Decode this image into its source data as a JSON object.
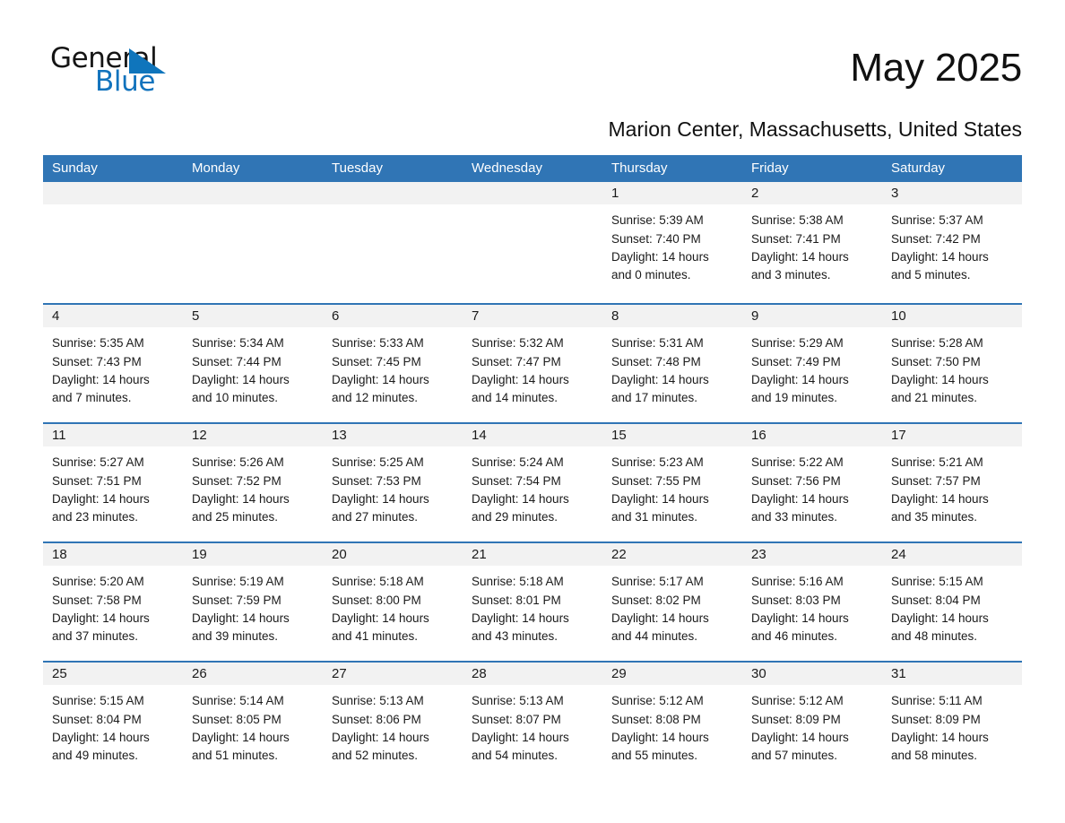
{
  "logo": {
    "word_one": "General",
    "word_two": "Blue",
    "triangle_color": "#0f75bc",
    "blue_text_color": "#1273bd"
  },
  "header": {
    "month_year": "May 2025",
    "location": "Marion Center, Massachusetts, United States",
    "header_bg_color": "#3075b5",
    "day_band_color": "#f2f2f2"
  },
  "weekdays": [
    "Sunday",
    "Monday",
    "Tuesday",
    "Wednesday",
    "Thursday",
    "Friday",
    "Saturday"
  ],
  "weeks": [
    [
      {
        "empty": true,
        "day": ""
      },
      {
        "empty": true,
        "day": ""
      },
      {
        "empty": true,
        "day": ""
      },
      {
        "empty": true,
        "day": ""
      },
      {
        "day": "1",
        "sunrise": "Sunrise: 5:39 AM",
        "sunset": "Sunset: 7:40 PM",
        "daylight_line1": "Daylight: 14 hours",
        "daylight_line2": "and 0 minutes."
      },
      {
        "day": "2",
        "sunrise": "Sunrise: 5:38 AM",
        "sunset": "Sunset: 7:41 PM",
        "daylight_line1": "Daylight: 14 hours",
        "daylight_line2": "and 3 minutes."
      },
      {
        "day": "3",
        "sunrise": "Sunrise: 5:37 AM",
        "sunset": "Sunset: 7:42 PM",
        "daylight_line1": "Daylight: 14 hours",
        "daylight_line2": "and 5 minutes."
      }
    ],
    [
      {
        "day": "4",
        "sunrise": "Sunrise: 5:35 AM",
        "sunset": "Sunset: 7:43 PM",
        "daylight_line1": "Daylight: 14 hours",
        "daylight_line2": "and 7 minutes."
      },
      {
        "day": "5",
        "sunrise": "Sunrise: 5:34 AM",
        "sunset": "Sunset: 7:44 PM",
        "daylight_line1": "Daylight: 14 hours",
        "daylight_line2": "and 10 minutes."
      },
      {
        "day": "6",
        "sunrise": "Sunrise: 5:33 AM",
        "sunset": "Sunset: 7:45 PM",
        "daylight_line1": "Daylight: 14 hours",
        "daylight_line2": "and 12 minutes."
      },
      {
        "day": "7",
        "sunrise": "Sunrise: 5:32 AM",
        "sunset": "Sunset: 7:47 PM",
        "daylight_line1": "Daylight: 14 hours",
        "daylight_line2": "and 14 minutes."
      },
      {
        "day": "8",
        "sunrise": "Sunrise: 5:31 AM",
        "sunset": "Sunset: 7:48 PM",
        "daylight_line1": "Daylight: 14 hours",
        "daylight_line2": "and 17 minutes."
      },
      {
        "day": "9",
        "sunrise": "Sunrise: 5:29 AM",
        "sunset": "Sunset: 7:49 PM",
        "daylight_line1": "Daylight: 14 hours",
        "daylight_line2": "and 19 minutes."
      },
      {
        "day": "10",
        "sunrise": "Sunrise: 5:28 AM",
        "sunset": "Sunset: 7:50 PM",
        "daylight_line1": "Daylight: 14 hours",
        "daylight_line2": "and 21 minutes."
      }
    ],
    [
      {
        "day": "11",
        "sunrise": "Sunrise: 5:27 AM",
        "sunset": "Sunset: 7:51 PM",
        "daylight_line1": "Daylight: 14 hours",
        "daylight_line2": "and 23 minutes."
      },
      {
        "day": "12",
        "sunrise": "Sunrise: 5:26 AM",
        "sunset": "Sunset: 7:52 PM",
        "daylight_line1": "Daylight: 14 hours",
        "daylight_line2": "and 25 minutes."
      },
      {
        "day": "13",
        "sunrise": "Sunrise: 5:25 AM",
        "sunset": "Sunset: 7:53 PM",
        "daylight_line1": "Daylight: 14 hours",
        "daylight_line2": "and 27 minutes."
      },
      {
        "day": "14",
        "sunrise": "Sunrise: 5:24 AM",
        "sunset": "Sunset: 7:54 PM",
        "daylight_line1": "Daylight: 14 hours",
        "daylight_line2": "and 29 minutes."
      },
      {
        "day": "15",
        "sunrise": "Sunrise: 5:23 AM",
        "sunset": "Sunset: 7:55 PM",
        "daylight_line1": "Daylight: 14 hours",
        "daylight_line2": "and 31 minutes."
      },
      {
        "day": "16",
        "sunrise": "Sunrise: 5:22 AM",
        "sunset": "Sunset: 7:56 PM",
        "daylight_line1": "Daylight: 14 hours",
        "daylight_line2": "and 33 minutes."
      },
      {
        "day": "17",
        "sunrise": "Sunrise: 5:21 AM",
        "sunset": "Sunset: 7:57 PM",
        "daylight_line1": "Daylight: 14 hours",
        "daylight_line2": "and 35 minutes."
      }
    ],
    [
      {
        "day": "18",
        "sunrise": "Sunrise: 5:20 AM",
        "sunset": "Sunset: 7:58 PM",
        "daylight_line1": "Daylight: 14 hours",
        "daylight_line2": "and 37 minutes."
      },
      {
        "day": "19",
        "sunrise": "Sunrise: 5:19 AM",
        "sunset": "Sunset: 7:59 PM",
        "daylight_line1": "Daylight: 14 hours",
        "daylight_line2": "and 39 minutes."
      },
      {
        "day": "20",
        "sunrise": "Sunrise: 5:18 AM",
        "sunset": "Sunset: 8:00 PM",
        "daylight_line1": "Daylight: 14 hours",
        "daylight_line2": "and 41 minutes."
      },
      {
        "day": "21",
        "sunrise": "Sunrise: 5:18 AM",
        "sunset": "Sunset: 8:01 PM",
        "daylight_line1": "Daylight: 14 hours",
        "daylight_line2": "and 43 minutes."
      },
      {
        "day": "22",
        "sunrise": "Sunrise: 5:17 AM",
        "sunset": "Sunset: 8:02 PM",
        "daylight_line1": "Daylight: 14 hours",
        "daylight_line2": "and 44 minutes."
      },
      {
        "day": "23",
        "sunrise": "Sunrise: 5:16 AM",
        "sunset": "Sunset: 8:03 PM",
        "daylight_line1": "Daylight: 14 hours",
        "daylight_line2": "and 46 minutes."
      },
      {
        "day": "24",
        "sunrise": "Sunrise: 5:15 AM",
        "sunset": "Sunset: 8:04 PM",
        "daylight_line1": "Daylight: 14 hours",
        "daylight_line2": "and 48 minutes."
      }
    ],
    [
      {
        "day": "25",
        "sunrise": "Sunrise: 5:15 AM",
        "sunset": "Sunset: 8:04 PM",
        "daylight_line1": "Daylight: 14 hours",
        "daylight_line2": "and 49 minutes."
      },
      {
        "day": "26",
        "sunrise": "Sunrise: 5:14 AM",
        "sunset": "Sunset: 8:05 PM",
        "daylight_line1": "Daylight: 14 hours",
        "daylight_line2": "and 51 minutes."
      },
      {
        "day": "27",
        "sunrise": "Sunrise: 5:13 AM",
        "sunset": "Sunset: 8:06 PM",
        "daylight_line1": "Daylight: 14 hours",
        "daylight_line2": "and 52 minutes."
      },
      {
        "day": "28",
        "sunrise": "Sunrise: 5:13 AM",
        "sunset": "Sunset: 8:07 PM",
        "daylight_line1": "Daylight: 14 hours",
        "daylight_line2": "and 54 minutes."
      },
      {
        "day": "29",
        "sunrise": "Sunrise: 5:12 AM",
        "sunset": "Sunset: 8:08 PM",
        "daylight_line1": "Daylight: 14 hours",
        "daylight_line2": "and 55 minutes."
      },
      {
        "day": "30",
        "sunrise": "Sunrise: 5:12 AM",
        "sunset": "Sunset: 8:09 PM",
        "daylight_line1": "Daylight: 14 hours",
        "daylight_line2": "and 57 minutes."
      },
      {
        "day": "31",
        "sunrise": "Sunrise: 5:11 AM",
        "sunset": "Sunset: 8:09 PM",
        "daylight_line1": "Daylight: 14 hours",
        "daylight_line2": "and 58 minutes."
      }
    ]
  ]
}
